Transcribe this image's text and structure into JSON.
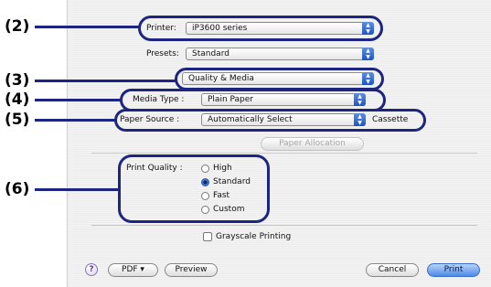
{
  "callouts": [
    "(2)",
    "(3)",
    "(4)",
    "(5)",
    "(6)"
  ],
  "printer": {
    "label": "Printer:",
    "value": "iP3600 series"
  },
  "presets": {
    "label": "Presets:",
    "value": "Standard"
  },
  "panel": {
    "value": "Quality & Media"
  },
  "media_type": {
    "label": "Media Type :",
    "value": "Plain Paper"
  },
  "paper_source": {
    "label": "Paper Source :",
    "value": "Automatically Select",
    "suffix": "Cassette"
  },
  "paper_allocation_button": "Paper Allocation",
  "print_quality": {
    "label": "Print Quality :",
    "options": [
      "High",
      "Standard",
      "Fast",
      "Custom"
    ],
    "selected": "Standard"
  },
  "grayscale": {
    "label": "Grayscale Printing",
    "checked": false
  },
  "footer": {
    "help": "?",
    "pdf": "PDF ▾",
    "preview": "Preview",
    "cancel": "Cancel",
    "print": "Print"
  },
  "colors": {
    "callout_ring": "#1c2580",
    "default_button": "#4c8ae8"
  }
}
